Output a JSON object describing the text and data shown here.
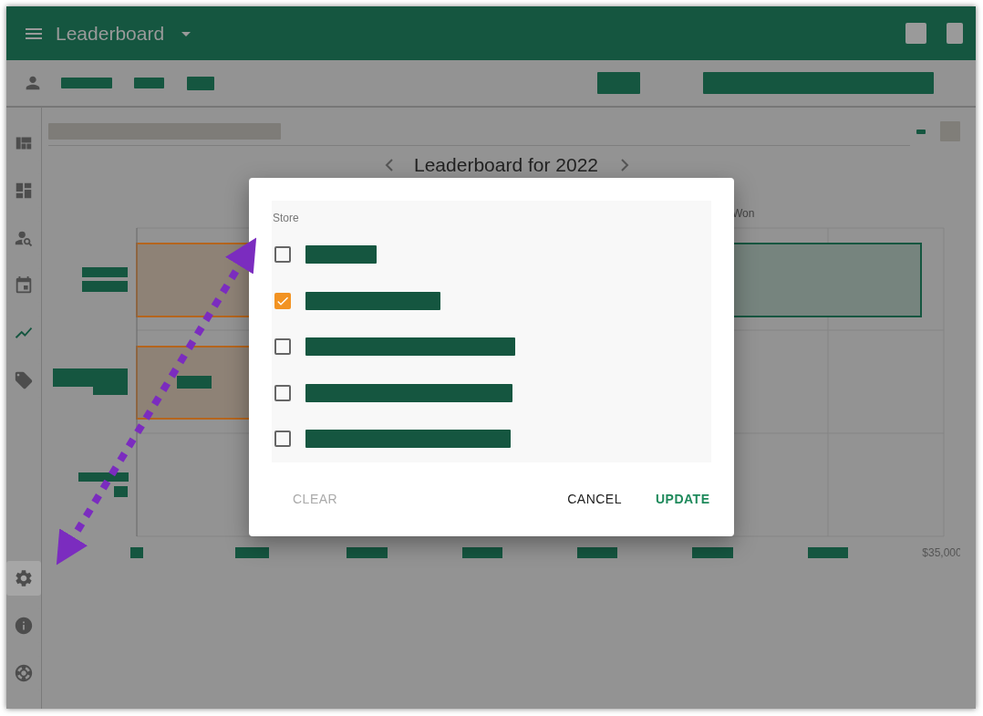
{
  "app_bar": {
    "title": "Leaderboard"
  },
  "sidebar": {
    "items": [
      {
        "selected": false
      },
      {
        "selected": false
      },
      {
        "selected": false
      },
      {
        "selected": false
      },
      {
        "selected": true
      },
      {
        "selected": false
      }
    ],
    "bottom_items": [
      {
        "focused": true
      },
      {
        "focused": false
      },
      {
        "focused": false
      }
    ]
  },
  "chart": {
    "title": "Leaderboard for 2022",
    "legend": "Won",
    "axis_label": "$35,000"
  },
  "dialog": {
    "label": "Store",
    "options": [
      {
        "checked": false
      },
      {
        "checked": true
      },
      {
        "checked": false
      },
      {
        "checked": false
      },
      {
        "checked": false
      }
    ],
    "buttons": [
      {
        "label": "CLEAR",
        "kind": "text",
        "disabled": true
      },
      {
        "label": "CANCEL",
        "kind": "text",
        "disabled": false
      },
      {
        "label": "UPDATE",
        "kind": "primary",
        "disabled": false
      }
    ]
  }
}
